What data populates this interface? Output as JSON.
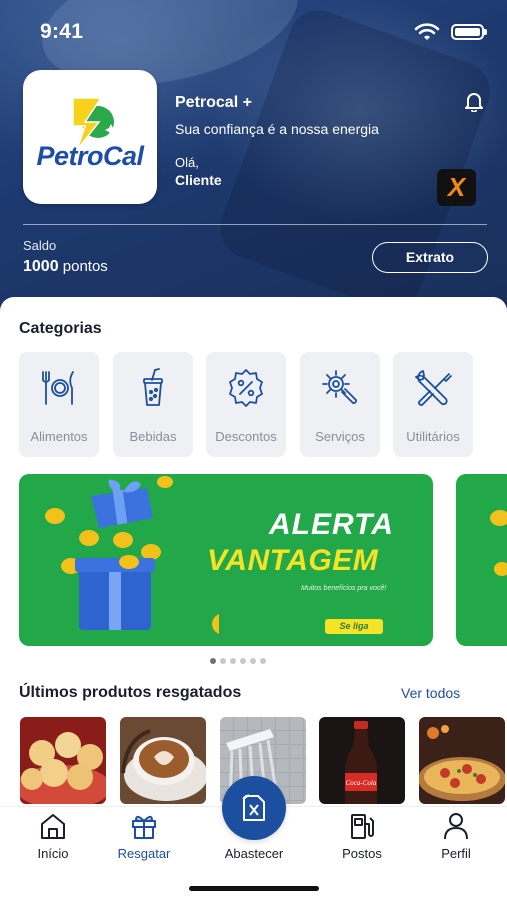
{
  "status_bar": {
    "time": "9:41"
  },
  "header": {
    "logo_text": "PetroCal",
    "brand_name": "Petrocal +",
    "slogan": "Sua confiança é a nossa energia",
    "greeting": "Olá,",
    "user_name": "Cliente",
    "partner_badge": "X",
    "balance_label": "Saldo",
    "balance_points": "1000",
    "balance_unit": "pontos",
    "statement_button": "Extrato"
  },
  "categories": {
    "title": "Categorias",
    "items": [
      {
        "label": "Alimentos",
        "icon": "cutlery-plate-icon"
      },
      {
        "label": "Bebidas",
        "icon": "drink-cup-icon"
      },
      {
        "label": "Descontos",
        "icon": "discount-badge-icon"
      },
      {
        "label": "Serviços",
        "icon": "gear-wrench-icon"
      },
      {
        "label": "Utilitários",
        "icon": "tools-icon"
      }
    ]
  },
  "banner": {
    "line1": "ALERTA",
    "line2": "VANTAGEM",
    "subtitle": "Muitos benefícios pra você!",
    "cta": "Se liga",
    "pages": 6,
    "active_page": 1
  },
  "recent": {
    "title": "Últimos produtos resgatados",
    "see_all": "Ver todos",
    "products": [
      "pão de queijo",
      "café",
      "chuveiro",
      "refrigerante",
      "pizza"
    ]
  },
  "bottom_nav": {
    "items": [
      {
        "label": "Início",
        "icon": "home-icon"
      },
      {
        "label": "Resgatar",
        "icon": "gift-icon",
        "active": true
      },
      {
        "label": "Abastecer",
        "icon": "fuel-can-icon"
      },
      {
        "label": "Postos",
        "icon": "fuel-pump-icon"
      },
      {
        "label": "Perfil",
        "icon": "user-icon"
      }
    ]
  },
  "colors": {
    "primary": "#1d4fa0",
    "banner_green": "#23a849",
    "banner_yellow": "#f5e326",
    "category_bg": "#eef0f3"
  }
}
